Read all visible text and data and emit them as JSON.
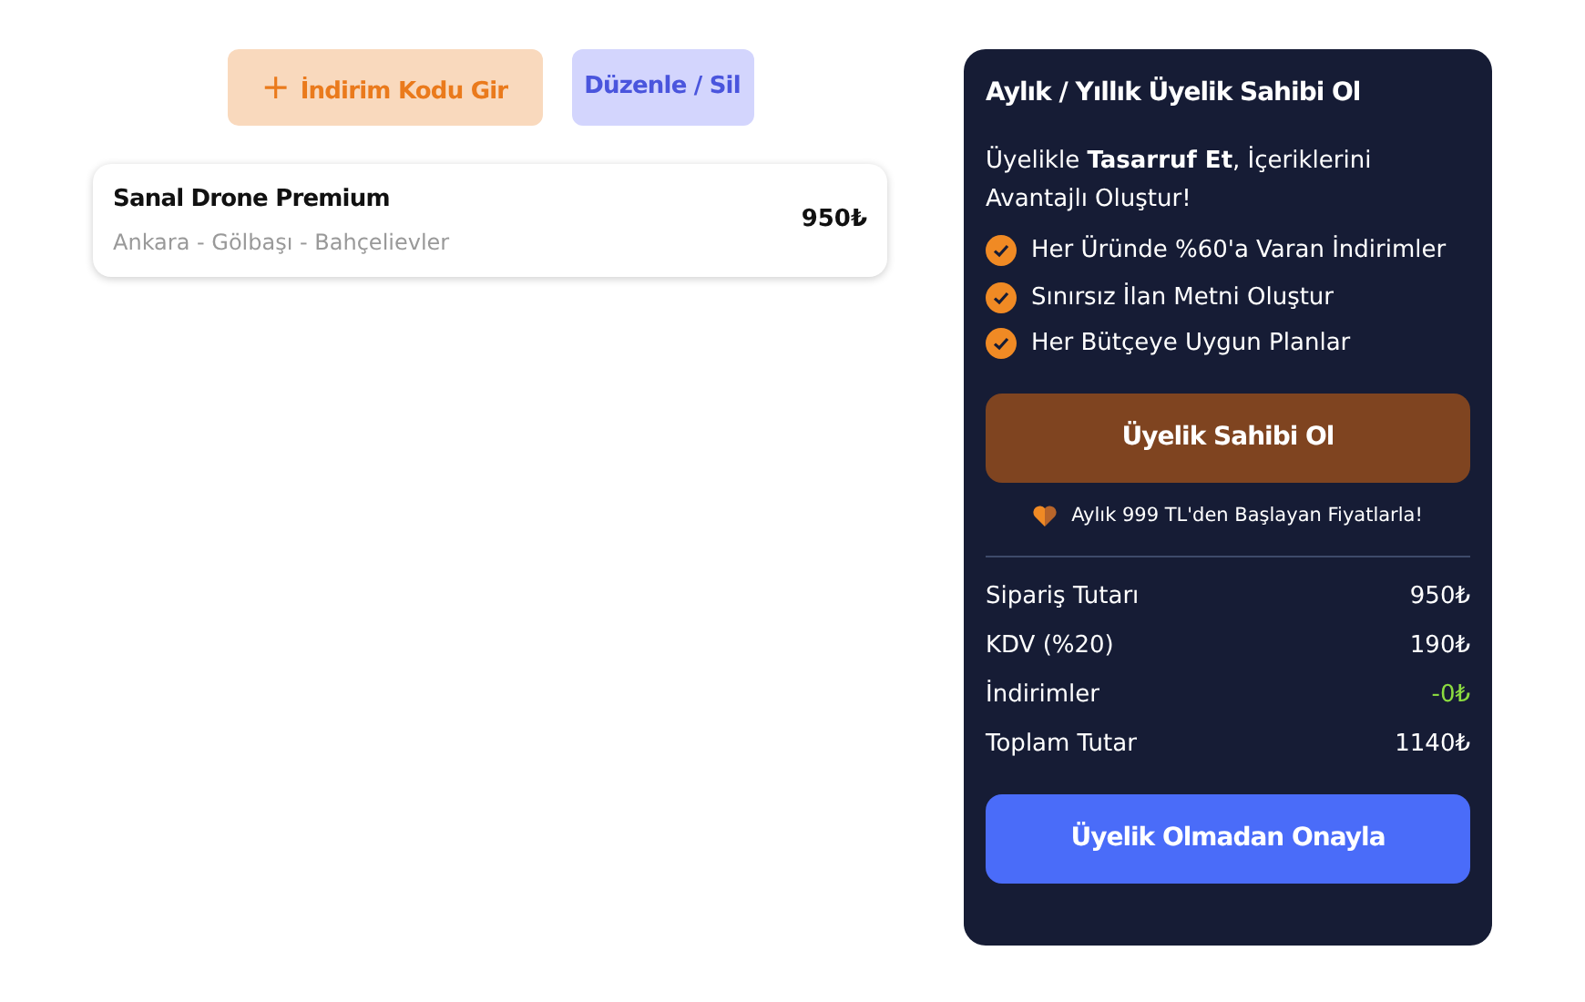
{
  "actions": [
    {
      "kind": "discount",
      "icon": "+",
      "label": "İndirim Kodu Gir"
    },
    {
      "kind": "edit",
      "label": "Düzenle / Sil"
    }
  ],
  "order_item": {
    "name": "Sanal Drone Premium",
    "location": "Ankara - Gölbaşı - Bahçelievler",
    "price": "950₺"
  },
  "membership": {
    "title": "Aylık / Yıllık Üyelik Sahibi Ol",
    "intro": "Üyelikle **Tasarruf Et**, İçeriklerini Avantajlı Oluştur!",
    "benefits": [
      "Her Üründe %60'a Varan İndirimler",
      "Sınırsız İlan Metni Oluştur",
      "Her Bütçeye Uygun Planlar"
    ],
    "button": "Üyelik Sahibi Ol",
    "note": "Aylık 999 TL'den Başlayan Fiyatlarla!"
  },
  "summary": [
    {
      "kind": "plain",
      "label": "Sipariş Tutarı",
      "value": "950₺"
    },
    {
      "kind": "plain",
      "label": "KDV (%20)",
      "value": "190₺"
    },
    {
      "kind": "discount",
      "label": "İndirimler",
      "value": "-0₺"
    },
    {
      "kind": "plain",
      "label": "Toplam Tutar",
      "value": "1140₺"
    }
  ],
  "confirm_button": "Üyelik Olmadan Onayla"
}
